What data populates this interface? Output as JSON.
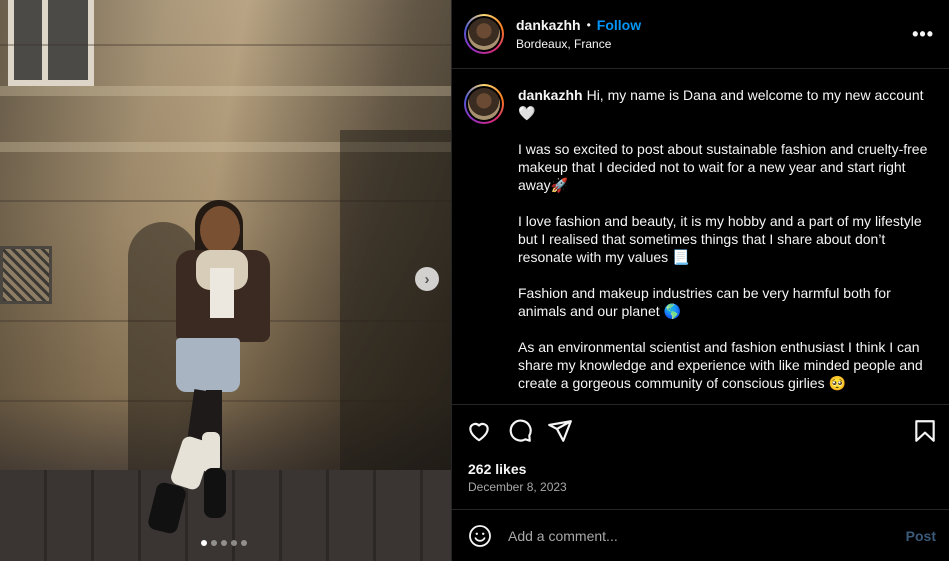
{
  "post": {
    "username": "dankazhh",
    "separator": "•",
    "follow_label": "Follow",
    "location": "Bordeaux, France",
    "more_label": "•••"
  },
  "caption": {
    "username": "dankazhh",
    "text": "Hi, my name is Dana and welcome to my new account🤍\n\nI was so excited to post about sustainable fashion and cruelty-free makeup that I decided not to wait for a new year and start right away🚀\n\nI love fashion and beauty, it is my hobby and a part of my lifestyle but I realised that sometimes things that I share about don’t resonate with my values 📃\n\nFashion and makeup industries can be very harmful both for animals and our planet 🌎\n\nAs an environmental scientist and fashion enthusiast I think I can share my knowledge and experience with like minded people and create a gorgeous community of conscious girlies 🥺"
  },
  "carousel": {
    "next_label": "›",
    "slide_count": 5,
    "active_index": 0
  },
  "engagement": {
    "likes": "262 likes",
    "date": "December 8, 2023"
  },
  "comment": {
    "placeholder": "Add a comment...",
    "post_label": "Post"
  },
  "icons": {
    "like": "heart-icon",
    "comment": "comment-icon",
    "share": "share-icon",
    "save": "bookmark-icon",
    "emoji": "emoji-icon"
  },
  "colors": {
    "follow": "#0095f6",
    "background": "#000000",
    "muted_text": "#a8a8a8"
  }
}
